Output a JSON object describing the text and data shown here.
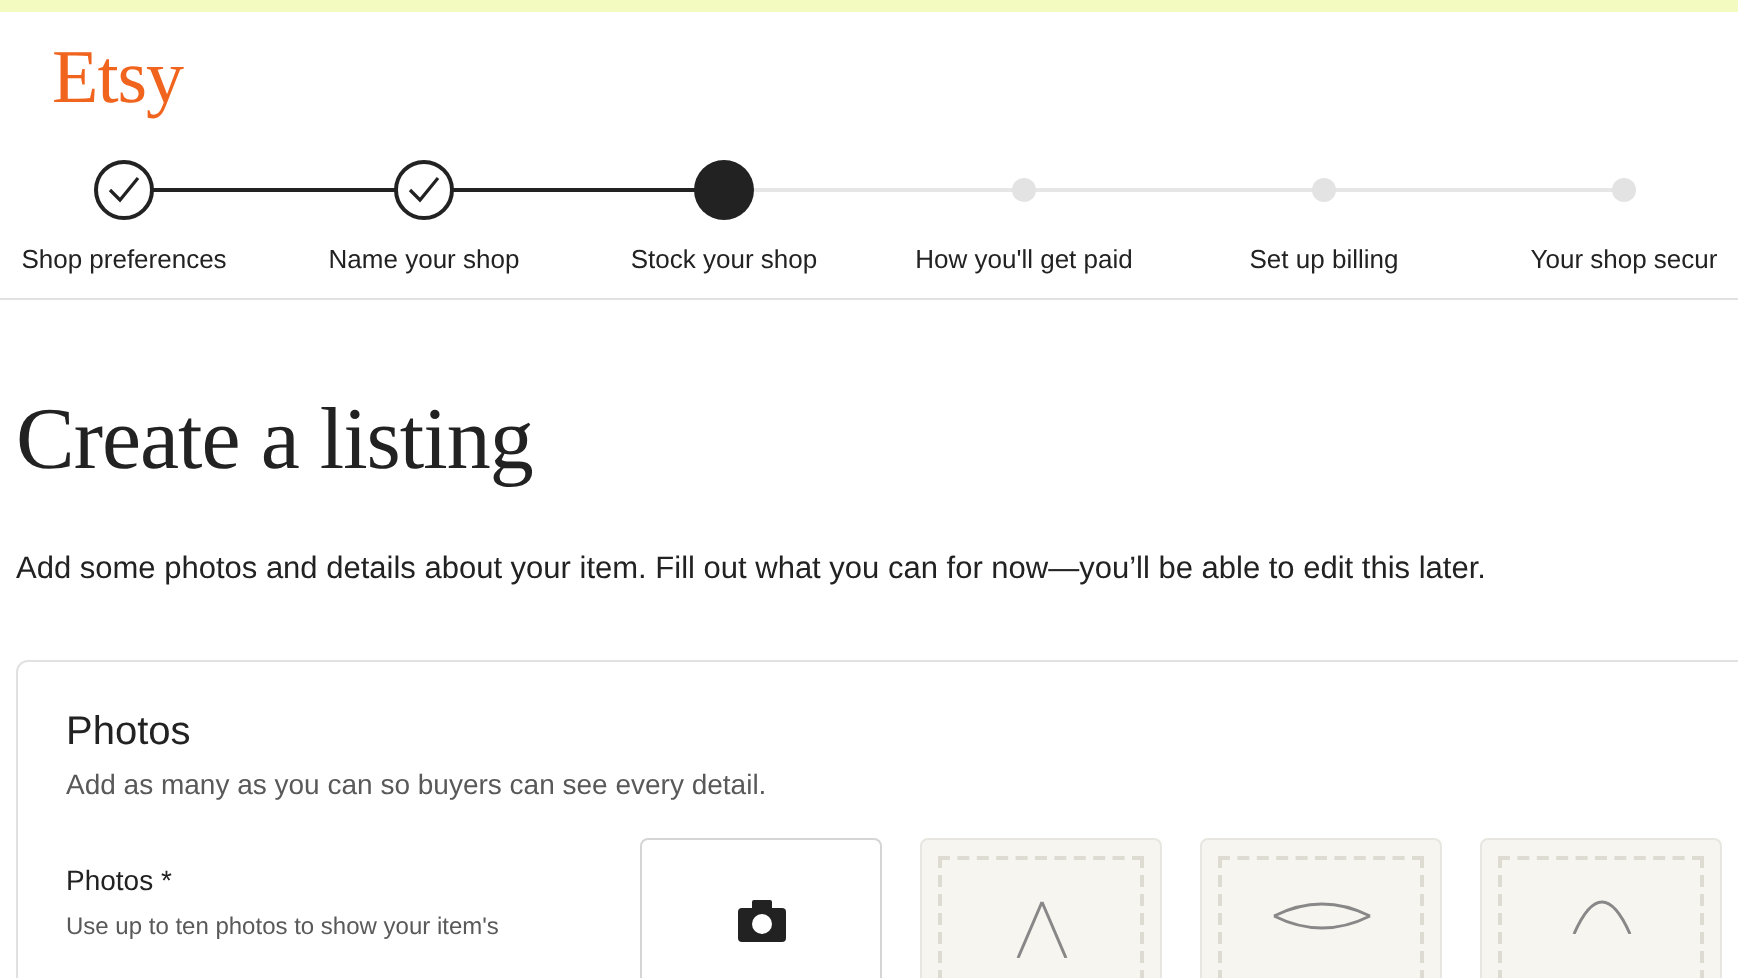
{
  "logo": "Etsy",
  "steps": [
    {
      "label": "Shop preferences",
      "completed": true,
      "selected": false
    },
    {
      "label": "Name your shop",
      "completed": true,
      "selected": false
    },
    {
      "label": "Stock your shop",
      "completed": false,
      "selected": true
    },
    {
      "label": "How you'll get paid",
      "completed": false,
      "selected": false
    },
    {
      "label": "Set up billing",
      "completed": false,
      "selected": false
    },
    {
      "label": "Your shop secur",
      "completed": false,
      "selected": false
    }
  ],
  "title": "Create a listing",
  "subtitle": "Add some photos and details about your item. Fill out what you can for now—you’ll be able to edit this later.",
  "photos_section": {
    "heading": "Photos",
    "description": "Add as many as you can so buyers can see every detail.",
    "field_label": "Photos *",
    "field_help": "Use up to ten photos to show your item's",
    "slots": [
      {
        "kind": "upload"
      },
      {
        "kind": "placeholder"
      },
      {
        "kind": "placeholder"
      },
      {
        "kind": "placeholder"
      }
    ]
  }
}
